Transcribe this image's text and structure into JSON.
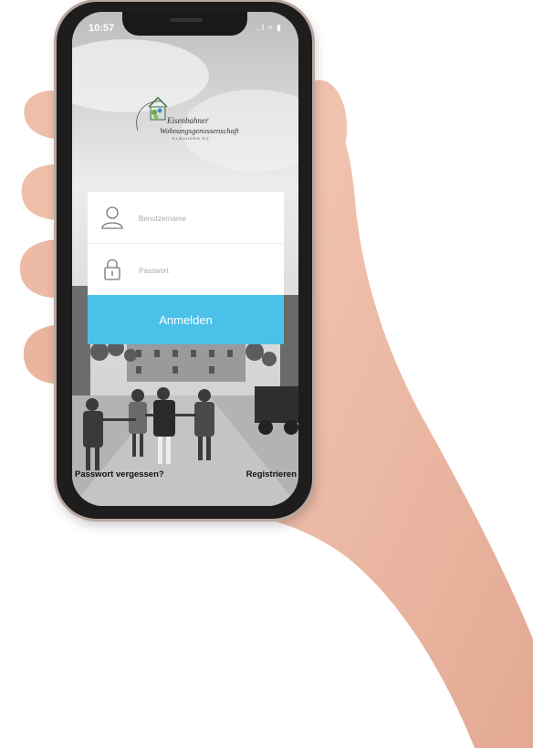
{
  "status_bar": {
    "time": "10:57",
    "icons": "..l ≈ ▮"
  },
  "logo": {
    "line1": "Eisenbahner",
    "line2": "Wohnungsgenossenschaft",
    "line3": "ELMSHORN EG"
  },
  "login": {
    "username_placeholder": "Benutzername",
    "password_placeholder": "Passwort",
    "submit_label": "Anmelden"
  },
  "links": {
    "forgot_password": "Passwort vergessen?",
    "register": "Registrieren"
  },
  "colors": {
    "accent": "#4bc1ea",
    "card": "#ffffff",
    "phone_frame": "#1e1c1c"
  }
}
